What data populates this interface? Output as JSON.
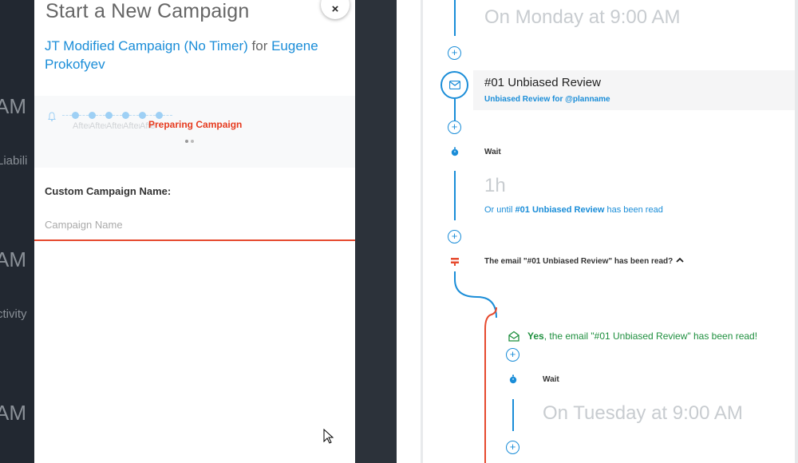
{
  "background": {
    "fragments": [
      "AM",
      "Liabili",
      "AM",
      "ctivity",
      "AM"
    ]
  },
  "modal": {
    "title": "Start a New Campaign",
    "close_label": "×",
    "subtitle": {
      "campaign": "JT Modified Campaign (No Timer)",
      "connector": "for",
      "contact": "Eugene Prokofyev"
    },
    "stepper": {
      "step_labels": [
        "After",
        "After",
        "After",
        "After",
        "After"
      ],
      "status": "Preparing Campaign"
    },
    "custom_name_label": "Custom Campaign Name:",
    "custom_name_placeholder": "Campaign Name",
    "custom_name_value": ""
  },
  "flow": {
    "top_time": "On Monday at 9:00 AM",
    "email": {
      "title": "#01 Unbiased Review",
      "subtitle": "Unbiased Review for @planname"
    },
    "wait1": {
      "label": "Wait",
      "duration": "1h",
      "until_prefix": "Or until",
      "until_email": "#01 Unbiased Review",
      "until_suffix": "has been read"
    },
    "condition": {
      "text": "The email \"#01 Unbiased Review\" has been read?"
    },
    "yes_branch": {
      "yes": "Yes",
      "text": ", the email \"#01 Unbiased Review\" has been read!"
    },
    "wait2": {
      "label": "Wait",
      "time": "On Tuesday at 9:00 AM"
    },
    "plus_label": "+"
  },
  "colors": {
    "accent": "#1a8dd8",
    "danger": "#e64a2e",
    "success": "#1e8f3e"
  }
}
